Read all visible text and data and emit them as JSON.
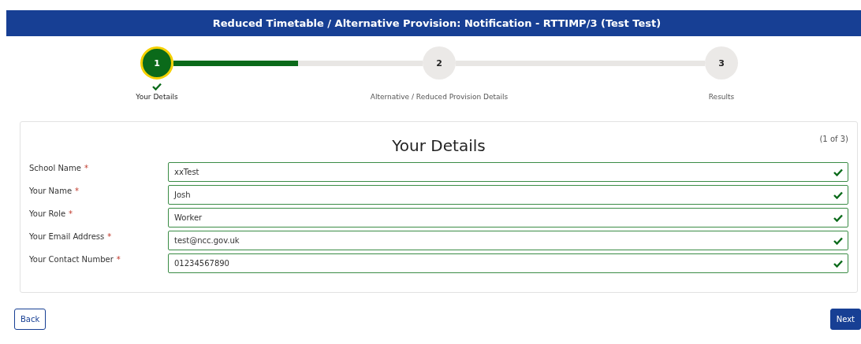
{
  "header": {
    "title": "Reduced Timetable / Alternative Provision: Notification - RTTIMP/3 (Test Test)"
  },
  "connectors": [
    {
      "level": 0.5
    }
  ],
  "steps": [
    {
      "number": "1",
      "label": "Your Details",
      "selected": true,
      "completed": true
    },
    {
      "number": "2",
      "label": "Alternative / Reduced Provision Details",
      "selected": false,
      "completed": false
    },
    {
      "number": "3",
      "label": "Results",
      "selected": false,
      "completed": false
    }
  ],
  "form": {
    "title": "Your Details",
    "page_count": "(1 of 3)",
    "required_mark": "*",
    "fields": [
      {
        "label": "School Name",
        "value": "xxTest",
        "required": true,
        "valid": true
      },
      {
        "label": "Your Name",
        "value": "Josh",
        "required": true,
        "valid": true
      },
      {
        "label": "Your Role",
        "value": "Worker",
        "required": true,
        "valid": true
      },
      {
        "label": "Your Email Address",
        "value": "test@ncc.gov.uk",
        "required": true,
        "valid": true
      },
      {
        "label": "Your Contact Number",
        "value": "01234567890",
        "required": true,
        "valid": true
      }
    ]
  },
  "buttons": {
    "back": "Back",
    "next": "Next"
  }
}
